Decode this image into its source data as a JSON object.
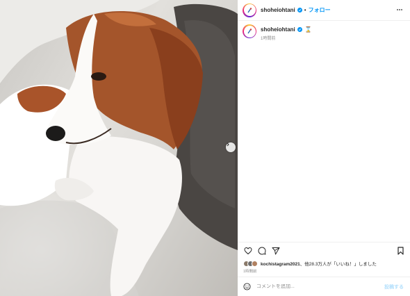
{
  "post": {
    "username": "shoheiohtani",
    "follow_label": "フォロー",
    "separator": "•",
    "caption_emoji": "⌛",
    "caption_time": "1時間前",
    "post_time": "1時間前"
  },
  "likes": {
    "liker": "kochistagram2021",
    "rest": "、他28.3万人が「いいね！」しました"
  },
  "comment": {
    "placeholder": "コメントを追加...",
    "post_label": "投稿する"
  },
  "icons": {
    "more": "more-horizontal-icon",
    "heart": "heart-icon",
    "comment": "comment-icon",
    "share": "paper-plane-icon",
    "bookmark": "bookmark-icon",
    "emoji": "smiley-icon",
    "next": "chevron-right-icon",
    "verified": "verified-badge-icon"
  },
  "colors": {
    "accent": "#0095f6",
    "post_disabled": "#b2dffc",
    "muted": "#8e8e8e"
  }
}
